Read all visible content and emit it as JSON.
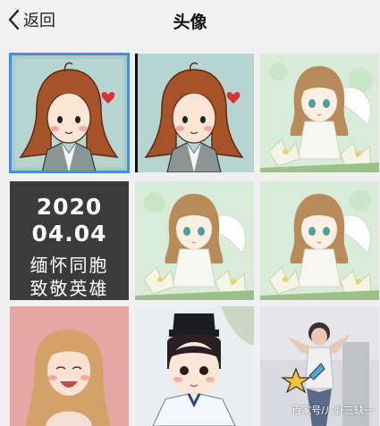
{
  "header": {
    "back_label": "返回",
    "title": "头像"
  },
  "date_tile": {
    "year": "2020",
    "day": "04.04",
    "line1": "缅怀同胞",
    "line2": "致敬英雄"
  },
  "watermark": "百家号/八卦三缺一",
  "colors": {
    "selection_border": "#3a8ff0",
    "header_bg": "#f2f2f2",
    "date_tile_bg": "#3b3b3b"
  }
}
